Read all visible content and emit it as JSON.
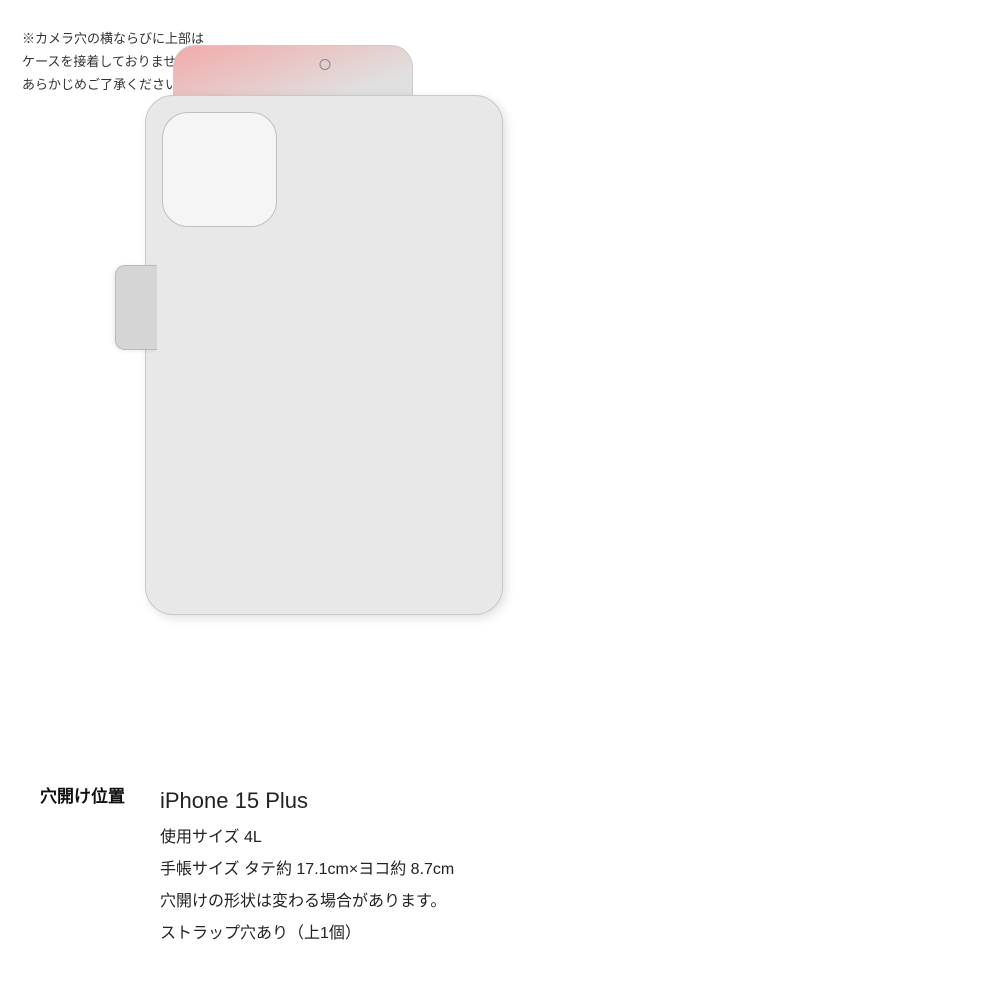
{
  "note": {
    "text": "※カメラ穴の横ならびに上部は\nケースを接着しておりません。\nあらかじめご了承ください。"
  },
  "hole_position_label": "穴開け位置",
  "specs": {
    "device_name": "iPhone 15 Plus",
    "size_label": "使用サイズ 4L",
    "dimensions_label": "手帳サイズ タテ約 17.1cm×ヨコ約 8.7cm",
    "shape_note": "穴開けの形状は変わる場合があります。",
    "strap_note": "ストラップ穴あり（上1個）"
  },
  "colors": {
    "case_bg": "#e8e8e8",
    "fold_color": "#f0a0a0",
    "side_strap_bg": "#d8d8d8",
    "text_primary": "#222222",
    "text_secondary": "#444444"
  }
}
